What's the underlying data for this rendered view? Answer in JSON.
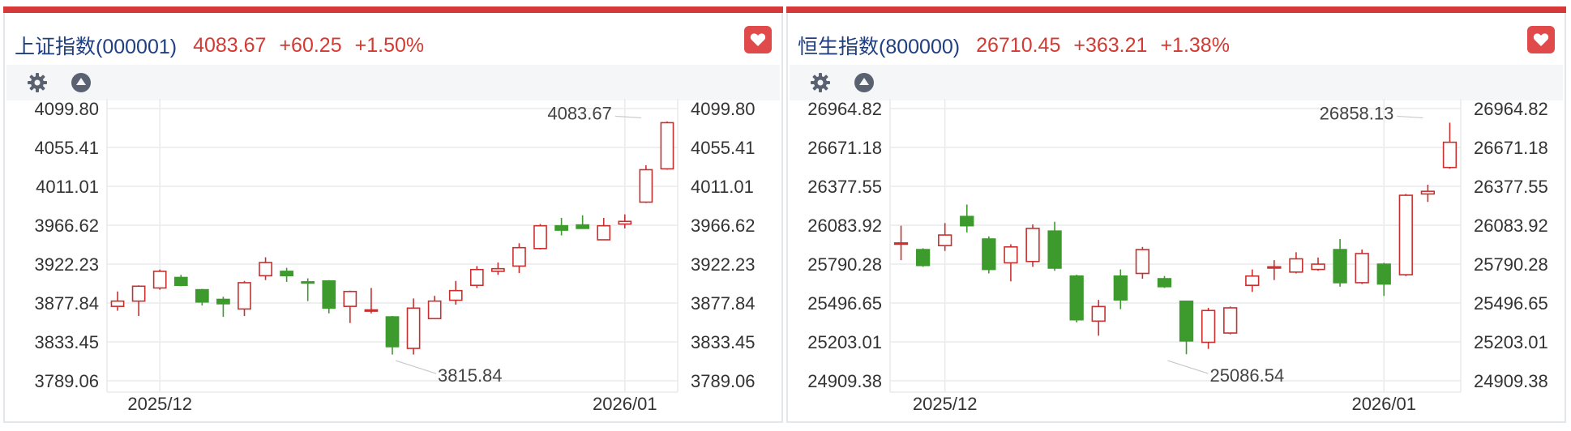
{
  "colors": {
    "up": "#c8302f",
    "down": "#3d9a2d",
    "accent": "#d6393a",
    "name": "#1f3f82"
  },
  "panels": [
    {
      "name": "上证指数(000001)",
      "price": "4083.67",
      "change": "+60.25",
      "pct": "+1.50%",
      "icons": [
        "gear-icon",
        "triangle-up-icon",
        "heart-icon"
      ]
    },
    {
      "name": "恒生指数(800000)",
      "price": "26710.45",
      "change": "+363.21",
      "pct": "+1.38%",
      "icons": [
        "gear-icon",
        "triangle-up-icon",
        "heart-icon"
      ]
    }
  ],
  "chart_data": [
    {
      "type": "candlestick",
      "ylim": [
        3789.06,
        4099.8
      ],
      "yticks": [
        "4099.80",
        "4055.41",
        "4011.01",
        "3966.62",
        "3922.23",
        "3877.84",
        "3833.45",
        "3789.06"
      ],
      "xticks": [
        "2025/12",
        "2026/01"
      ],
      "xtick_index": [
        2,
        24
      ],
      "annotations": [
        {
          "text": "4083.67",
          "index": 25,
          "value": 4083.67,
          "side": "high"
        },
        {
          "text": "3815.84",
          "index": 13,
          "value": 3815.84,
          "side": "low"
        }
      ],
      "candles": [
        [
          3874,
          3880,
          3891,
          3869
        ],
        [
          3880,
          3897,
          3898,
          3863
        ],
        [
          3895,
          3914,
          3916,
          3893
        ],
        [
          3907,
          3898,
          3910,
          3897
        ],
        [
          3893,
          3879,
          3894,
          3875
        ],
        [
          3882,
          3877,
          3885,
          3862
        ],
        [
          3871,
          3901,
          3903,
          3863
        ],
        [
          3909,
          3924,
          3930,
          3904
        ],
        [
          3914,
          3909,
          3918,
          3902
        ],
        [
          3902,
          3901,
          3906,
          3880
        ],
        [
          3903,
          3872,
          3904,
          3866
        ],
        [
          3874,
          3891,
          3892,
          3855
        ],
        [
          3869,
          3870,
          3895,
          3866
        ],
        [
          3862,
          3828,
          3863,
          3819
        ],
        [
          3826,
          3872,
          3883,
          3819
        ],
        [
          3860,
          3880,
          3886,
          3860
        ],
        [
          3881,
          3892,
          3903,
          3876
        ],
        [
          3898,
          3916,
          3920,
          3895
        ],
        [
          3914,
          3917,
          3924,
          3910
        ],
        [
          3920,
          3941,
          3946,
          3912
        ],
        [
          3940,
          3966,
          3968,
          3939
        ],
        [
          3966,
          3961,
          3975,
          3955
        ],
        [
          3967,
          3963,
          3978,
          3963
        ],
        [
          3950,
          3966,
          3975,
          3950
        ],
        [
          3968,
          3971,
          3979,
          3963
        ],
        [
          3993,
          4030,
          4035,
          3992
        ],
        [
          4031,
          4083.67,
          4085,
          4030
        ]
      ]
    },
    {
      "type": "candlestick",
      "ylim": [
        24909.38,
        26964.82
      ],
      "yticks": [
        "26964.82",
        "26671.18",
        "26377.55",
        "26083.92",
        "25790.28",
        "25496.65",
        "25203.01",
        "24909.38"
      ],
      "xticks": [
        "2025/12",
        "2026/01"
      ],
      "xtick_index": [
        2,
        22
      ],
      "annotations": [
        {
          "text": "26858.13",
          "index": 24,
          "value": 26858.13,
          "side": "high"
        },
        {
          "text": "25086.54",
          "index": 12,
          "value": 25086.54,
          "side": "low"
        }
      ],
      "candles": [
        [
          25945,
          25950,
          26080,
          25820
        ],
        [
          25900,
          25780,
          25910,
          25770
        ],
        [
          25930,
          26010,
          26100,
          25890
        ],
        [
          26150,
          26080,
          26240,
          26030
        ],
        [
          25980,
          25750,
          26000,
          25720
        ],
        [
          25800,
          25920,
          25940,
          25660
        ],
        [
          25810,
          26060,
          26090,
          25770
        ],
        [
          26040,
          25760,
          26110,
          25740
        ],
        [
          25700,
          25370,
          25710,
          25350
        ],
        [
          25360,
          25470,
          25520,
          25250
        ],
        [
          25700,
          25520,
          25750,
          25450
        ],
        [
          25720,
          25900,
          25920,
          25680
        ],
        [
          25680,
          25620,
          25700,
          25610
        ],
        [
          25510,
          25210,
          25510,
          25110
        ],
        [
          25200,
          25440,
          25460,
          25150
        ],
        [
          25270,
          25460,
          25470,
          25260
        ],
        [
          25630,
          25700,
          25750,
          25580
        ],
        [
          25760,
          25770,
          25820,
          25670
        ],
        [
          25730,
          25830,
          25880,
          25720
        ],
        [
          25750,
          25790,
          25840,
          25740
        ],
        [
          25900,
          25650,
          25980,
          25620
        ],
        [
          25650,
          25870,
          25900,
          25640
        ],
        [
          25790,
          25640,
          25800,
          25550
        ],
        [
          25710,
          26310,
          26320,
          25700
        ],
        [
          26320,
          26340,
          26390,
          26260
        ],
        [
          26520,
          26710.45,
          26858.13,
          26510
        ]
      ]
    }
  ]
}
